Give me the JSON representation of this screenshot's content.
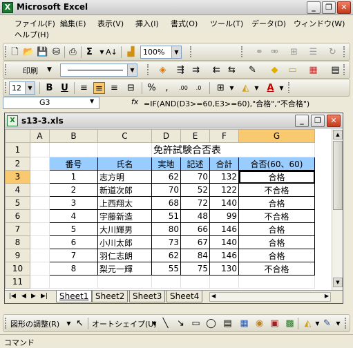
{
  "window": {
    "title": "Microsoft Excel"
  },
  "menu": {
    "items": [
      "ファイル(F)",
      "編集(E)",
      "表示(V)",
      "挿入(I)",
      "書式(O)",
      "ツール(T)",
      "データ(D)",
      "ウィンドウ(W)"
    ],
    "help": "ヘルプ(H)"
  },
  "toolbar": {
    "zoom": "100%",
    "print_label": "印刷",
    "font_size": "12"
  },
  "formula": {
    "cell_ref": "G3",
    "fx": "fx",
    "text": "=IF(AND(D3>=60,E3>=60),\"合格\",\"不合格\")"
  },
  "workbook": {
    "filename": "s13-3.xls",
    "columns": [
      "A",
      "B",
      "C",
      "D",
      "E",
      "F",
      "G"
    ],
    "row_numbers": [
      "1",
      "2",
      "3",
      "4",
      "5",
      "6",
      "7",
      "8",
      "9",
      "10",
      "11"
    ],
    "sheet_title": "免許試験合否表",
    "headers": [
      "番号",
      "氏名",
      "実地",
      "記述",
      "合計",
      "合否(60、60)"
    ],
    "rows": [
      [
        "1",
        "志方明",
        "62",
        "70",
        "132",
        "合格"
      ],
      [
        "2",
        "新道次郎",
        "70",
        "52",
        "122",
        "不合格"
      ],
      [
        "3",
        "上西翔太",
        "68",
        "72",
        "140",
        "合格"
      ],
      [
        "4",
        "宇藤新造",
        "51",
        "48",
        "99",
        "不合格"
      ],
      [
        "5",
        "大川輝男",
        "80",
        "66",
        "146",
        "合格"
      ],
      [
        "6",
        "小川太郎",
        "73",
        "67",
        "140",
        "合格"
      ],
      [
        "7",
        "羽仁志朗",
        "62",
        "84",
        "146",
        "合格"
      ],
      [
        "8",
        "梨元一輝",
        "55",
        "75",
        "130",
        "不合格"
      ]
    ],
    "tabs": [
      "Sheet1",
      "Sheet2",
      "Sheet3",
      "Sheet4"
    ]
  },
  "drawing": {
    "adjust_label": "図形の調整(R)",
    "autoshape_label": "オートシェイプ(U)"
  },
  "status": {
    "text": "コマンド"
  }
}
